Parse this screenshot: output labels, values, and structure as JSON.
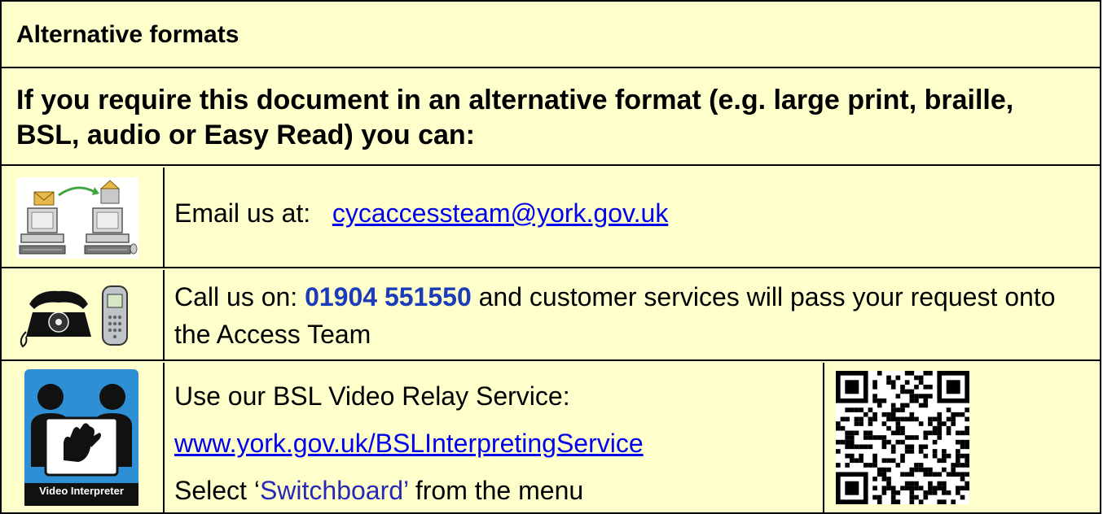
{
  "header": {
    "title": "Alternative formats"
  },
  "intro": {
    "text": "If you require this document in an alternative format (e.g. large print, braille, BSL, audio or Easy Read) you can:"
  },
  "email": {
    "label": "Email us at:",
    "address": "cycaccessteam@york.gov.uk",
    "icon": "computers-email-icon"
  },
  "phone": {
    "prefix": "Call us on: ",
    "number": "01904 551550",
    "suffix": " and customer services will pass your request onto the Access Team",
    "icon": "telephone-icon"
  },
  "bsl": {
    "line1": "Use our BSL Video Relay Service:",
    "link": "www.york.gov.uk/BSLInterpretingService",
    "line3_prefix": "Select ‘",
    "line3_highlight": "Switchboard’",
    "line3_suffix": " from the menu",
    "badge_label": "Video Interpreter",
    "icon": "video-interpreter-icon",
    "qr": "qr-code"
  },
  "colors": {
    "background": "#ffffcc",
    "link": "#0000ee",
    "phone": "#1a3cb8",
    "badge": "#2e8fd4"
  }
}
